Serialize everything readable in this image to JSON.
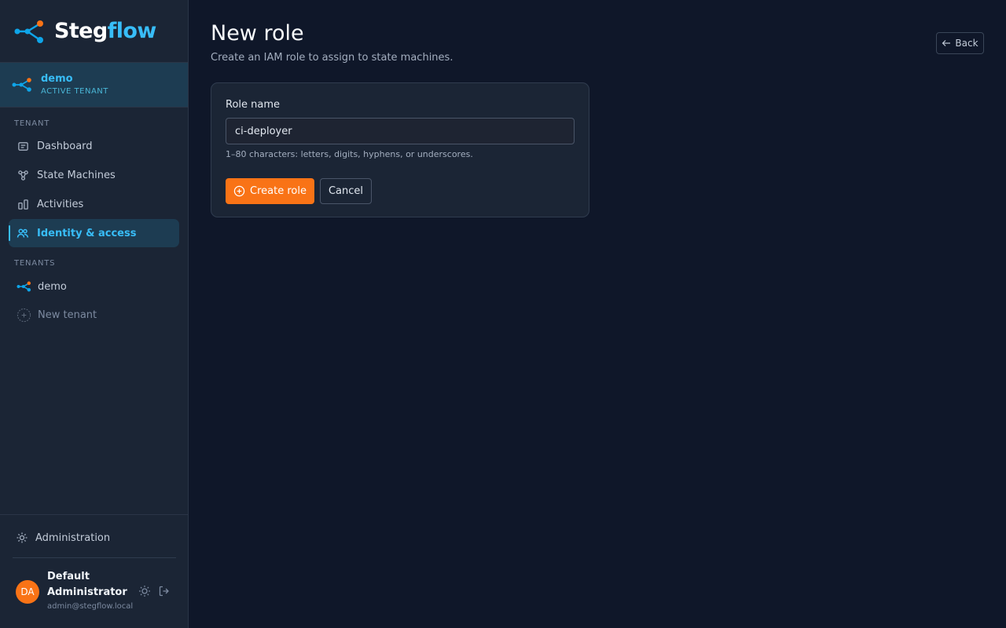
{
  "brand": {
    "name_part1": "Steg",
    "name_part2": "flow",
    "logo": "flow-nodes-logo"
  },
  "active_tenant": {
    "name": "demo",
    "subtitle": "ACTIVE TENANT"
  },
  "sidebar": {
    "tenant_section_label": "TENANT",
    "nav": [
      {
        "label": "Dashboard",
        "icon": "dashboard-icon"
      },
      {
        "label": "State Machines",
        "icon": "state-machines-icon"
      },
      {
        "label": "Activities",
        "icon": "activities-icon"
      },
      {
        "label": "Identity & access",
        "icon": "users-icon",
        "active": true
      }
    ],
    "tenants_section_label": "TENANTS",
    "tenants": [
      {
        "label": "demo",
        "icon": "tenant-flow-icon"
      },
      {
        "label": "New tenant",
        "icon": "plus-circle-icon"
      }
    ],
    "admin_label": "Administration"
  },
  "user": {
    "initials": "DA",
    "name": "Default Administrator",
    "email": "admin@stegflow.local"
  },
  "page": {
    "title": "New role",
    "subtitle": "Create an IAM role to assign to state machines.",
    "back_label": "Back"
  },
  "form": {
    "role_name_label": "Role name",
    "role_name_value": "ci-deployer",
    "hint": "1–80 characters: letters, digits, hyphens, or underscores.",
    "submit_label": "Create role",
    "cancel_label": "Cancel"
  },
  "colors": {
    "accent": "#38bdf8",
    "primary_button": "#f97316",
    "background": "#0f1729",
    "sidebar": "#1b2535"
  }
}
